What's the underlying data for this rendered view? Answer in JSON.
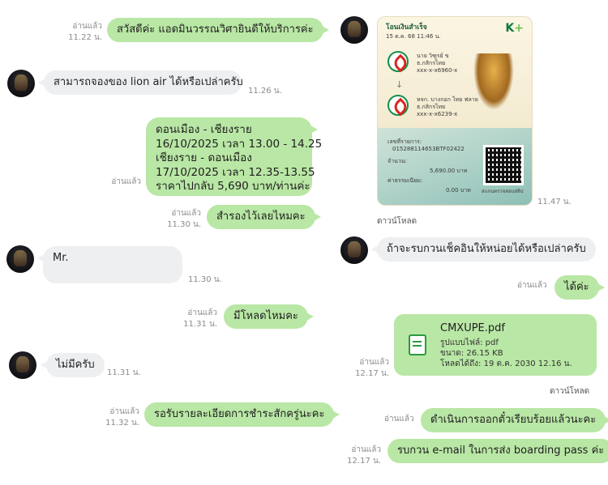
{
  "left": {
    "m1": {
      "text": "สวัสดีค่ะ แอดมินวรรณวิศายินดีให้บริการค่ะ",
      "read": "อ่านแล้ว",
      "time": "11.22 น."
    },
    "m2": {
      "text": "สามารถจองของ lion air ได้หรือเปล่าครับ",
      "time": "11.26 น."
    },
    "m3": {
      "lines": [
        "ดอนเมือง - เชียงราย",
        "16/10/2025 เวลา 13.00 - 14.25",
        "เชียงราย - ดอนเมือง",
        "17/10/2025 เวลา 12.35-13.55",
        "ราคาไปกลับ 5,690 บาท/ท่านค่ะ"
      ],
      "read": "อ่านแล้ว"
    },
    "m4": {
      "text": "สำรองไว้เลยไหมคะ",
      "read": "อ่านแล้ว",
      "time": "11.30 น."
    },
    "m5": {
      "text": "Mr.",
      "time": "11.30 น."
    },
    "m6": {
      "text": "มีโหลดไหมคะ",
      "read": "อ่านแล้ว",
      "time": "11.31 น."
    },
    "m7": {
      "text": "ไม่มีครับ",
      "time": "11.31 น."
    },
    "m8": {
      "text": "รอรับรายละเอียดการชำระสักครู่นะคะ",
      "read": "อ่านแล้ว",
      "time": "11.32 น."
    }
  },
  "right": {
    "slip": {
      "title": "โอนเงินสำเร็จ",
      "date": "15 ต.ค. 68 11:46 น.",
      "brand": "K",
      "brand_plus": "+",
      "from_name": "นาย วิฑูรย์ ข",
      "from_bank": "ธ.กสิกรไทย",
      "from_acct": "xxx-x-x6960-x",
      "to_name": "หจก. บางกอก ไทย ฟลาย",
      "to_bank": "ธ.กสิกรไทย",
      "to_acct": "xxx-x-x6239-x",
      "ref_label": "เลขที่รายการ:",
      "ref": "015288114653BTF02422",
      "amount_label": "จำนวน:",
      "amount": "5,690.00 บาท",
      "fee_label": "ค่าธรรมเนียม:",
      "fee": "0.00 บาท",
      "qr_caption": "สแกนตรวจสอบสลิป",
      "time": "11.47 น.",
      "download": "ดาวน์โหลด"
    },
    "m9": {
      "text": "ถ้าจะรบกวนเช็คอินให้หน่อยได้หรือเปล่าครับ"
    },
    "m10": {
      "text": "ได้ค่ะ",
      "read": "อ่านแล้ว"
    },
    "file": {
      "name": "CMXUPE.pdf",
      "type": "รูปแบบไฟล์: pdf",
      "size": "ขนาด: 26.15 KB",
      "expiry": "โหลดได้ถึง: 19 ต.ค. 2030 12.16 น.",
      "read": "อ่านแล้ว",
      "time": "12.17 น.",
      "download": "ดาวน์โหลด"
    },
    "m11": {
      "text": "ดำเนินการออกตั๋วเรียบร้อยแล้วนะคะ",
      "read": "อ่านแล้ว"
    },
    "m12": {
      "text": "รบกวน e-mail ในการส่ง boarding pass ค่ะ",
      "read": "อ่านแล้ว",
      "time": "12.17 น."
    }
  }
}
